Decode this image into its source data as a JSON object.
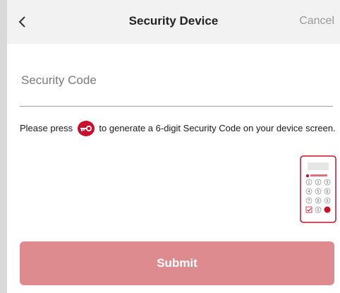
{
  "header": {
    "title": "Security Device",
    "cancel_label": "Cancel"
  },
  "form": {
    "security_code_placeholder": "Security Code",
    "security_code_value": ""
  },
  "instruction": {
    "before_icon": "Please press",
    "after_icon": "to generate a 6-digit Security Code on your device screen."
  },
  "device": {
    "keys": [
      "1",
      "2",
      "3",
      "4",
      "5",
      "6",
      "7",
      "8",
      "9",
      "0"
    ]
  },
  "actions": {
    "submit_label": "Submit"
  },
  "colors": {
    "accent": "#c8102e",
    "submit_bg": "#de8b8f",
    "header_bg": "#f2f2f2"
  },
  "icons": {
    "back": "chevron-left-icon",
    "key": "key-icon"
  }
}
